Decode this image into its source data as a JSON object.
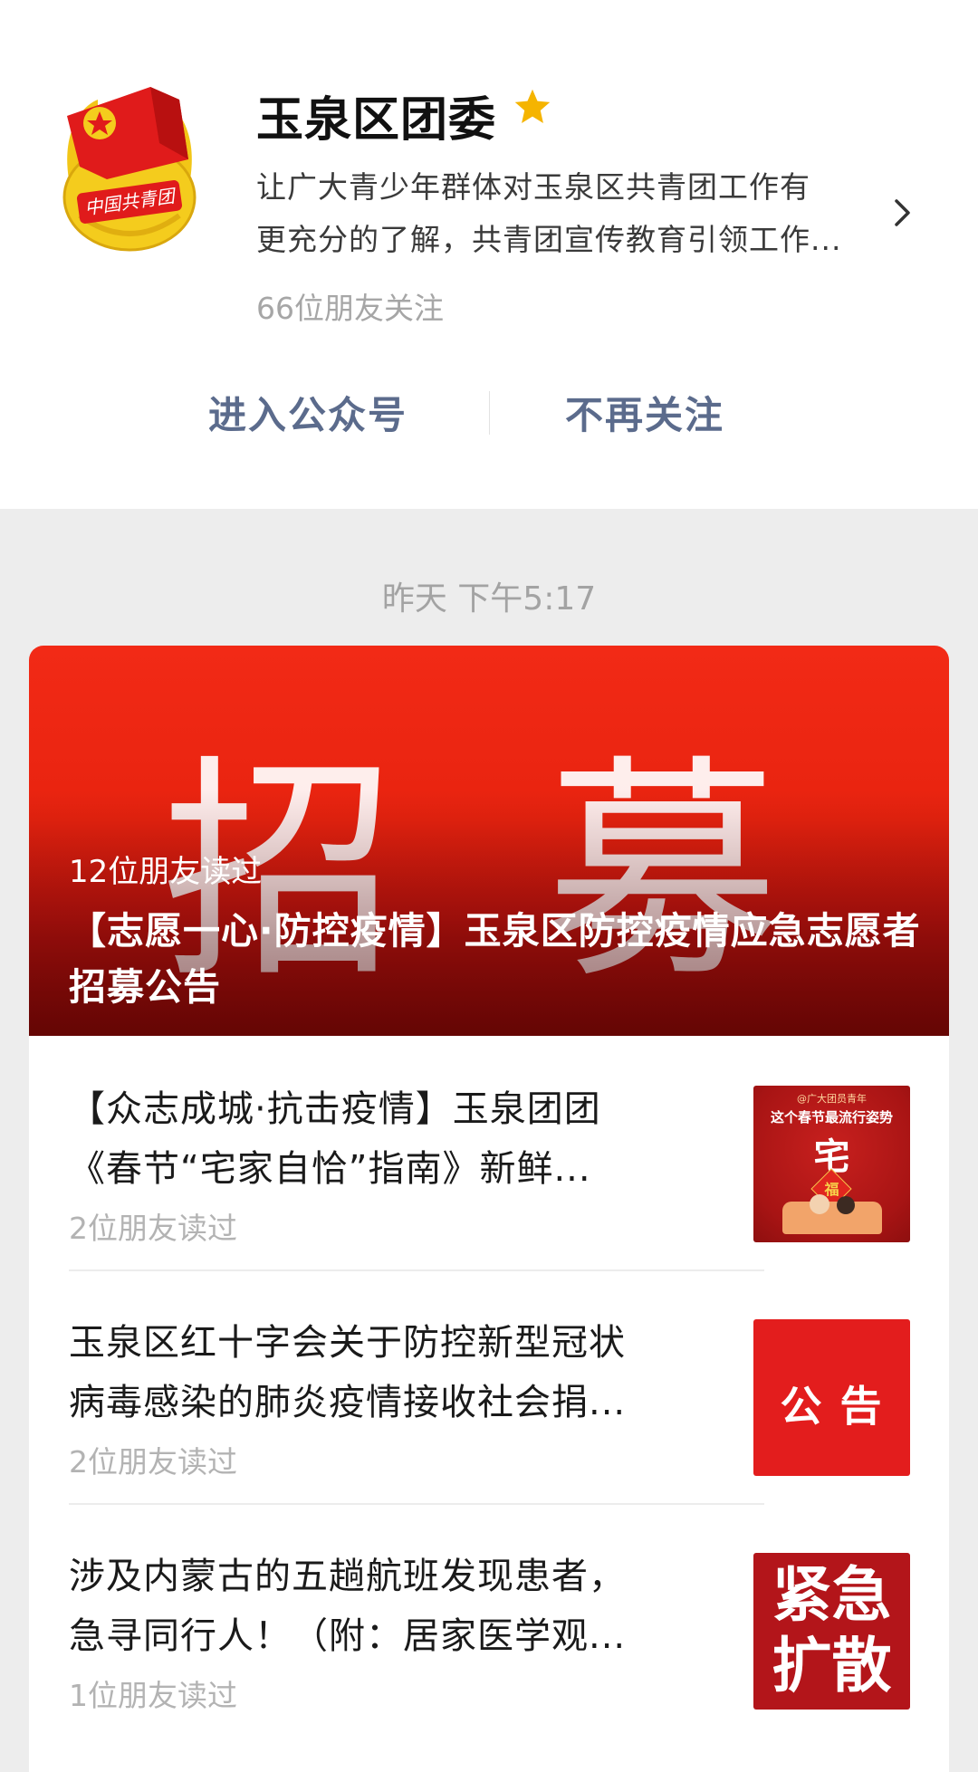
{
  "account": {
    "name": "玉泉区团委",
    "description_line1": "让广大青少年群体对玉泉区共青团工作有",
    "description_line2": "更充分的了解，共青团宣传教育引领工作...",
    "followers": "66位朋友关注",
    "logo_text": "中国共青团"
  },
  "actions": {
    "enter": "进入公众号",
    "unfollow": "不再关注"
  },
  "timestamp": "昨天 下午5:17",
  "cover_article": {
    "bg_chars": "招 募",
    "reads": "12位朋友读过",
    "title": "【志愿一心·防控疫情】玉泉区防控疫情应急志愿者招募公告"
  },
  "articles": [
    {
      "title_line1": "【众志成城·抗击疫情】玉泉团团",
      "title_line2": "《春节“宅家自恰”指南》新鲜...",
      "reads": "2位朋友读过",
      "thumb_top": "@广大团员青年",
      "thumb_mid": "这个春节最流行姿势",
      "thumb_big": "宅",
      "thumb_small": "福"
    },
    {
      "title_line1": "玉泉区红十字会关于防控新型冠状",
      "title_line2": "病毒感染的肺炎疫情接收社会捐...",
      "reads": "2位朋友读过",
      "thumb_text": "公 告"
    },
    {
      "title_line1": "涉及内蒙古的五趟航班发现患者，",
      "title_line2": "急寻同行人！（附：居家医学观...",
      "reads": "1位朋友读过",
      "thumb_line1": "紧急",
      "thumb_line2": "扩散"
    }
  ],
  "colors": {
    "brand_red": "#e3231a",
    "link_blue": "#5b6b8c",
    "star": "#f5b400"
  }
}
